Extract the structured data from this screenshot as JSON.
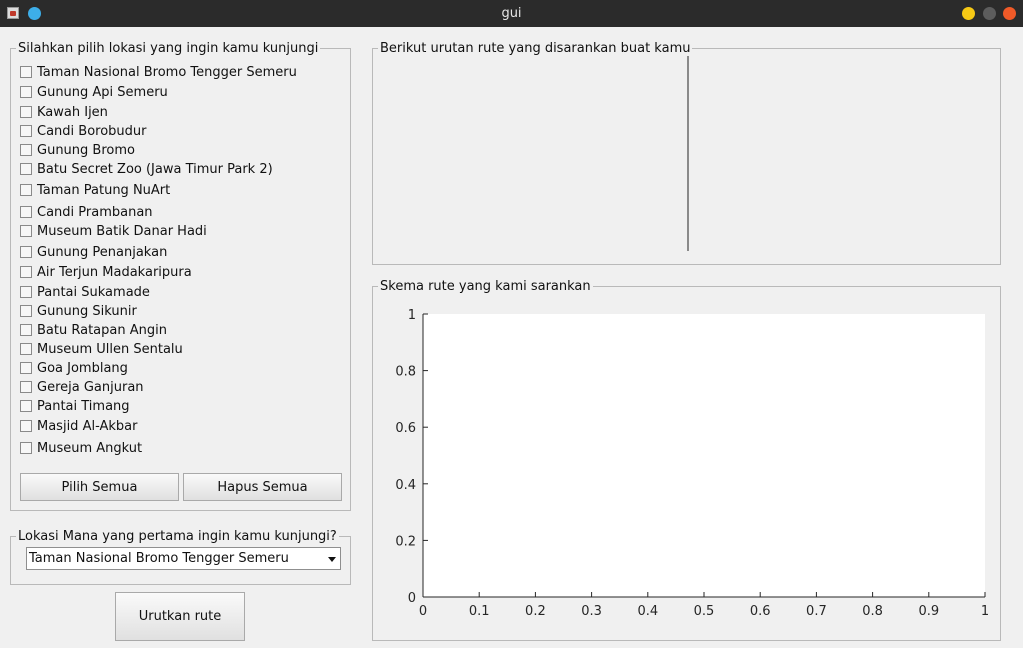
{
  "window": {
    "title": "gui"
  },
  "location_panel": {
    "title": "Silahkan pilih lokasi yang ingin kamu kunjungi",
    "locations": [
      "Taman Nasional Bromo Tengger Semeru",
      "Gunung Api Semeru",
      "Kawah Ijen",
      "Candi Borobudur",
      "Gunung Bromo",
      "Batu Secret Zoo (Jawa Timur Park 2)",
      "Taman Patung NuArt",
      "Candi Prambanan",
      "Museum Batik Danar Hadi",
      "Gunung Penanjakan",
      "Air Terjun Madakaripura",
      "Pantai Sukamade",
      "Gunung Sikunir",
      "Batu Ratapan Angin",
      "Museum Ullen Sentalu",
      "Goa Jomblang",
      "Gereja Ganjuran",
      "Pantai Timang",
      "Masjid Al-Akbar",
      "Museum Angkut"
    ],
    "select_all_label": "Pilih Semua",
    "clear_all_label": "Hapus Semua"
  },
  "first_location_panel": {
    "title": "Lokasi Mana yang pertama ingin kamu kunjungi?",
    "selected": "Taman Nasional Bromo Tengger Semeru"
  },
  "sort_button_label": "Urutkan rute",
  "route_order_panel": {
    "title": "Berikut urutan rute yang disarankan buat kamu"
  },
  "route_scheme_panel": {
    "title": "Skema rute yang kami sarankan"
  },
  "chart_data": {
    "type": "line",
    "series": [],
    "xlim": [
      0,
      1
    ],
    "ylim": [
      0,
      1
    ],
    "xticks": [
      "0",
      "0.1",
      "0.2",
      "0.3",
      "0.4",
      "0.5",
      "0.6",
      "0.7",
      "0.8",
      "0.9",
      "1"
    ],
    "yticks": [
      "0",
      "0.2",
      "0.4",
      "0.6",
      "0.8",
      "1"
    ],
    "title": "",
    "xlabel": "",
    "ylabel": "",
    "grid": false
  }
}
